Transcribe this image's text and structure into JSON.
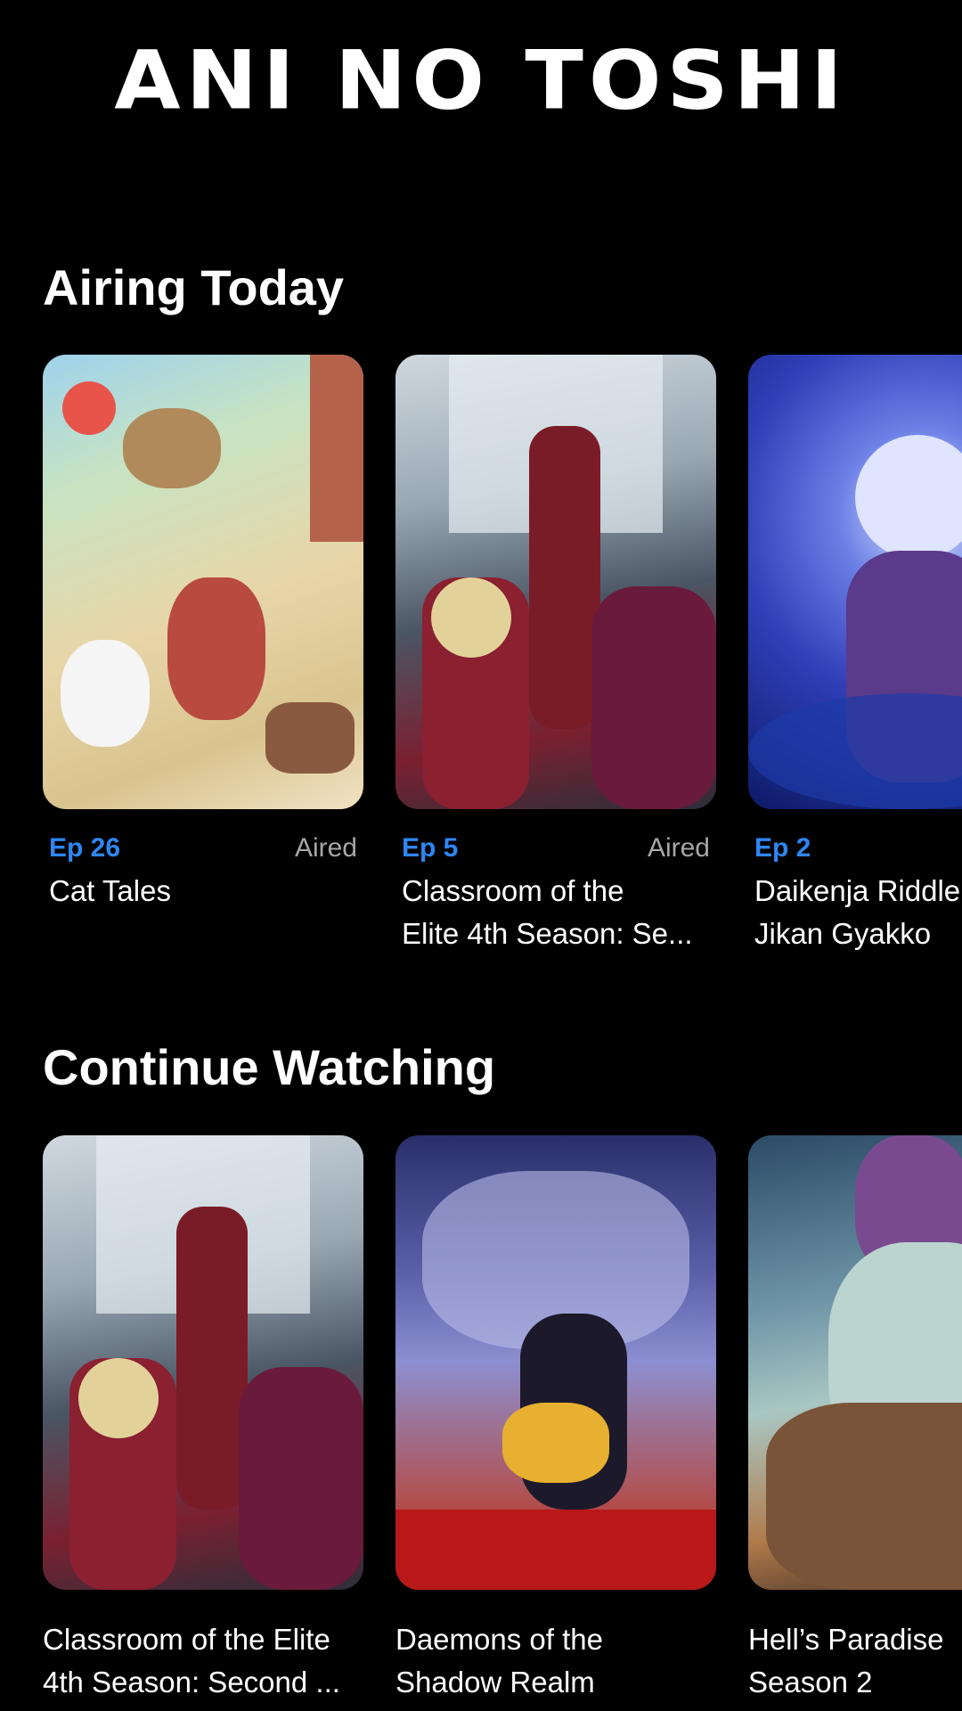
{
  "app": {
    "logo_text": "ANI NO TOSHI"
  },
  "airing_today": {
    "heading": "Airing Today",
    "items": [
      {
        "episode": "Ep 26",
        "status": "Aired",
        "title_line1": "Cat Tales",
        "title_line2": ""
      },
      {
        "episode": "Ep 5",
        "status": "Aired",
        "title_line1": "Classroom of the",
        "title_line2": "Elite 4th Season: Se..."
      },
      {
        "episode": "Ep 2",
        "status": "",
        "title_line1": "Daikenja Riddle",
        "title_line2": "Jikan Gyakko"
      }
    ]
  },
  "continue_watching": {
    "heading": "Continue Watching",
    "items": [
      {
        "title_line1": "Classroom of the Elite",
        "title_line2": "4th Season: Second ..."
      },
      {
        "title_line1": "Daemons of the",
        "title_line2": "Shadow Realm"
      },
      {
        "title_line1": "Hell’s Paradise",
        "title_line2": "Season 2"
      }
    ]
  },
  "colors": {
    "background": "#000000",
    "accent": "#2f86f2",
    "muted": "#a6a6a6"
  }
}
